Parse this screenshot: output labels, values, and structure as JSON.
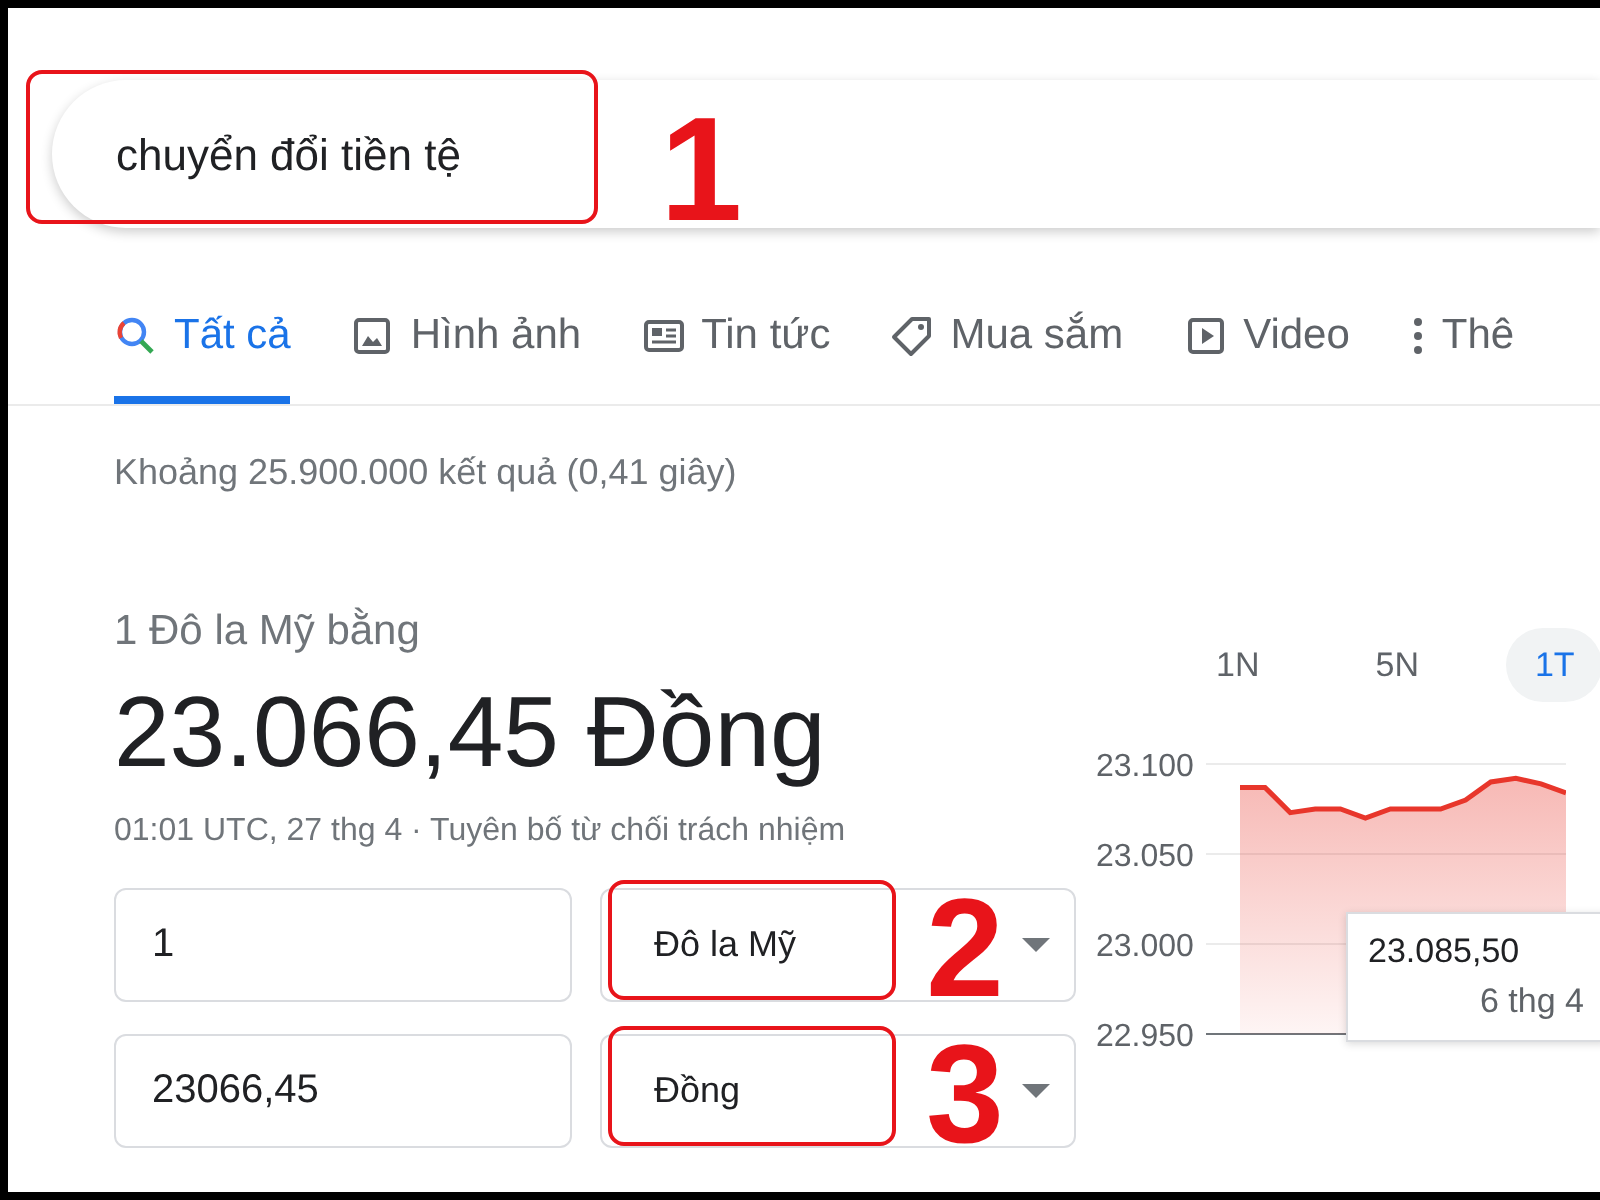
{
  "search": {
    "value": "chuyển đổi tiền tệ"
  },
  "callouts": [
    {
      "label": "1"
    },
    {
      "label": "2"
    },
    {
      "label": "3"
    }
  ],
  "tabs": [
    {
      "label": "Tất cả",
      "selected": true
    },
    {
      "label": "Hình ảnh",
      "selected": false
    },
    {
      "label": "Tin tức",
      "selected": false
    },
    {
      "label": "Mua sắm",
      "selected": false
    },
    {
      "label": "Video",
      "selected": false
    },
    {
      "label": "Thê",
      "selected": false
    }
  ],
  "result_stats": "Khoảng 25.900.000 kết quả (0,41 giây)",
  "converter": {
    "heading": "1 Đô la Mỹ bằng",
    "result": "23.066,45 Đồng",
    "timestamp": "01:01 UTC, 27 thg 4 · Tuyên bố từ chối trách nhiệm",
    "rows": [
      {
        "value": "1",
        "currency": "Đô la Mỹ"
      },
      {
        "value": "23066,45",
        "currency": "Đồng"
      }
    ]
  },
  "chart": {
    "periods": [
      {
        "label": "1N",
        "selected": false
      },
      {
        "label": "5N",
        "selected": false
      },
      {
        "label": "1T",
        "selected": true
      }
    ],
    "tooltip": {
      "value": "23.085,50",
      "date": "6 thg 4"
    },
    "chart_data": {
      "type": "line",
      "values": [
        23087,
        23087,
        23073,
        23075,
        23075,
        23070,
        23075,
        23075,
        23075,
        23080,
        23090,
        23092,
        23089,
        23084
      ],
      "ylim": [
        22950,
        23100
      ],
      "yticks": [
        {
          "value": 23100,
          "label": "23.100"
        },
        {
          "value": 23050,
          "label": "23.050"
        },
        {
          "value": 23000,
          "label": "23.000"
        },
        {
          "value": 22950,
          "label": "22.950"
        }
      ]
    }
  }
}
